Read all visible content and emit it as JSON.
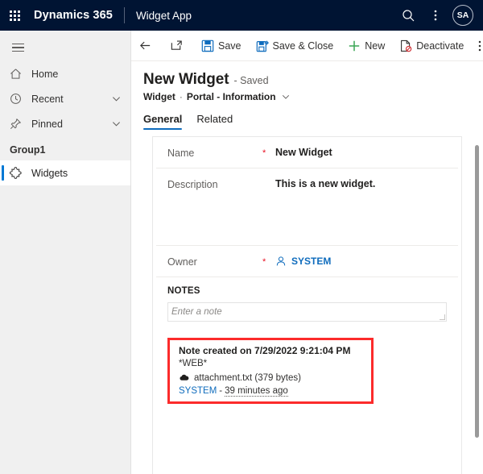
{
  "topbar": {
    "waffle_label": "App launcher",
    "brand": "Dynamics 365",
    "app_name": "Widget App",
    "search_icon": "search-icon",
    "more_icon": "more-vertical-icon",
    "avatar_initials": "SA"
  },
  "sidebar": {
    "hamburger_label": "Site map",
    "items": [
      {
        "label": "Home",
        "icon": "home-icon",
        "chevron": false,
        "selected": false
      },
      {
        "label": "Recent",
        "icon": "clock-icon",
        "chevron": true,
        "selected": false
      },
      {
        "label": "Pinned",
        "icon": "pin-icon",
        "chevron": true,
        "selected": false
      }
    ],
    "group_label": "Group1",
    "group_items": [
      {
        "label": "Widgets",
        "icon": "puzzle-icon",
        "selected": true
      }
    ]
  },
  "commandbar": {
    "back_label": "Back",
    "popout_label": "Open in new window",
    "save_label": "Save",
    "save_close_label": "Save & Close",
    "new_label": "New",
    "deactivate_label": "Deactivate",
    "overflow_label": "More commands"
  },
  "header": {
    "title": "New Widget",
    "status": "- Saved",
    "breadcrumb_entity": "Widget",
    "breadcrumb_sep": "·",
    "breadcrumb_form": "Portal - Information"
  },
  "tabs": [
    {
      "label": "General",
      "active": true
    },
    {
      "label": "Related",
      "active": false
    }
  ],
  "form": {
    "name_label": "Name",
    "name_value": "New Widget",
    "name_required": "*",
    "description_label": "Description",
    "description_value": "This is a new widget.",
    "owner_label": "Owner",
    "owner_required": "*",
    "owner_value": "SYSTEM",
    "notes_header": "NOTES",
    "note_placeholder": "Enter a note"
  },
  "note_card": {
    "title": "Note created on 7/29/2022 9:21:04 PM",
    "body": "*WEB*",
    "attachment": "attachment.txt (379 bytes)",
    "author": "SYSTEM",
    "separator": "-",
    "timestamp": "39 minutes ago"
  },
  "colors": {
    "header_bg": "#001433",
    "accent": "#0f6cbd",
    "required": "#e81123",
    "highlight": "#fc2b2b",
    "sidebar_bg": "#f0f0f0"
  }
}
